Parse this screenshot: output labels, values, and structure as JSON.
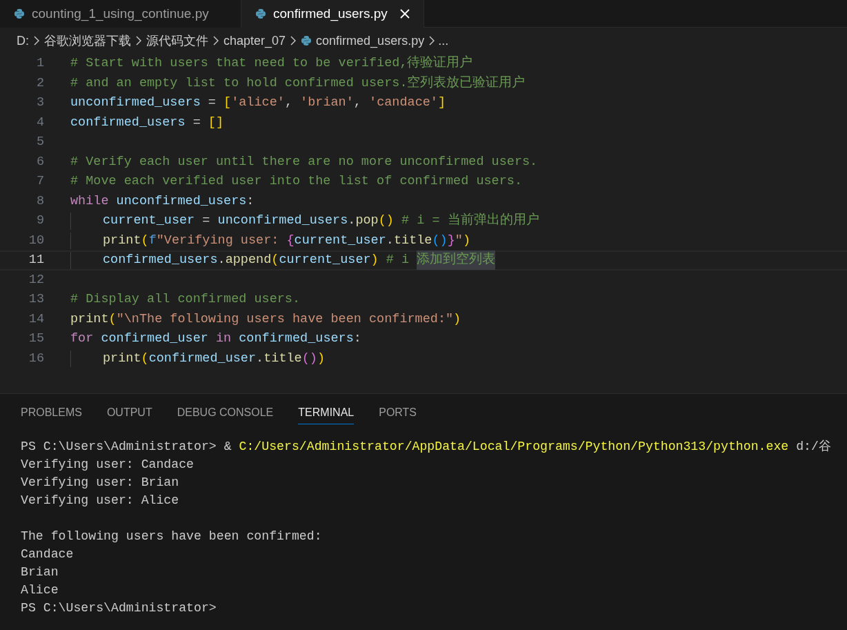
{
  "tabs": [
    {
      "label": "counting_1_using_continue.py",
      "selected": false
    },
    {
      "label": "confirmed_users.py",
      "selected": true
    }
  ],
  "breadcrumb": [
    {
      "label": "D:",
      "kind": "folder"
    },
    {
      "label": "谷歌浏览器下载",
      "kind": "folder"
    },
    {
      "label": "源代码文件",
      "kind": "folder"
    },
    {
      "label": "chapter_07",
      "kind": "folder"
    },
    {
      "label": "confirmed_users.py",
      "kind": "file"
    },
    {
      "label": "...",
      "kind": "more"
    }
  ],
  "code_lines": [
    {
      "number": "1",
      "current": false,
      "indented": false,
      "tokens": [
        {
          "text": "# Start with users that need to be verified,待验证用户",
          "kind": "comment"
        }
      ]
    },
    {
      "number": "2",
      "current": false,
      "indented": false,
      "tokens": [
        {
          "text": "# and an empty list to hold confirmed users.空列表放已验证用户",
          "kind": "comment"
        }
      ]
    },
    {
      "number": "3",
      "current": false,
      "indented": false,
      "tokens": [
        {
          "text": "unconfirmed_users",
          "kind": "variable"
        },
        {
          "text": " = ",
          "kind": "plain"
        },
        {
          "text": "[",
          "kind": "bracket1"
        },
        {
          "text": "'alice'",
          "kind": "string"
        },
        {
          "text": ", ",
          "kind": "plain"
        },
        {
          "text": "'brian'",
          "kind": "string"
        },
        {
          "text": ", ",
          "kind": "plain"
        },
        {
          "text": "'candace'",
          "kind": "string"
        },
        {
          "text": "]",
          "kind": "bracket1"
        }
      ]
    },
    {
      "number": "4",
      "current": false,
      "indented": false,
      "tokens": [
        {
          "text": "confirmed_users",
          "kind": "variable"
        },
        {
          "text": " = ",
          "kind": "plain"
        },
        {
          "text": "[]",
          "kind": "bracket1"
        }
      ]
    },
    {
      "number": "5",
      "current": false,
      "indented": false
    },
    {
      "number": "6",
      "current": false,
      "indented": false,
      "tokens": [
        {
          "text": "# Verify each user until there are no more unconfirmed users.",
          "kind": "comment"
        }
      ]
    },
    {
      "number": "7",
      "current": false,
      "indented": false,
      "tokens": [
        {
          "text": "# Move each verified user into the list of confirmed users.",
          "kind": "comment"
        }
      ]
    },
    {
      "number": "8",
      "current": false,
      "indented": false,
      "tokens": [
        {
          "text": "while",
          "kind": "keyword"
        },
        {
          "text": " unconfirmed_users",
          "kind": "variable"
        },
        {
          "text": ":",
          "kind": "plain"
        }
      ]
    },
    {
      "number": "9",
      "current": false,
      "indented": true,
      "tokens": [
        {
          "text": "current_user",
          "kind": "variable"
        },
        {
          "text": " = ",
          "kind": "plain"
        },
        {
          "text": "unconfirmed_users",
          "kind": "variable"
        },
        {
          "text": ".",
          "kind": "plain"
        },
        {
          "text": "pop",
          "kind": "function"
        },
        {
          "text": "()",
          "kind": "bracket1"
        },
        {
          "text": " # i = 当前弹出的用户",
          "kind": "comment"
        }
      ]
    },
    {
      "number": "10",
      "current": false,
      "indented": true,
      "tokens": [
        {
          "text": "print",
          "kind": "function"
        },
        {
          "text": "(",
          "kind": "bracket1"
        },
        {
          "text": "f",
          "kind": "storage"
        },
        {
          "text": "\"Verifying user: ",
          "kind": "string"
        },
        {
          "text": "{",
          "kind": "bracket2"
        },
        {
          "text": "current_user",
          "kind": "variable"
        },
        {
          "text": ".",
          "kind": "plain"
        },
        {
          "text": "title",
          "kind": "function"
        },
        {
          "text": "()",
          "kind": "bracket3"
        },
        {
          "text": "}",
          "kind": "bracket2"
        },
        {
          "text": "\"",
          "kind": "string"
        },
        {
          "text": ")",
          "kind": "bracket1"
        }
      ]
    },
    {
      "number": "11",
      "current": true,
      "indented": true,
      "tokens": [
        {
          "text": "confirmed_users",
          "kind": "variable"
        },
        {
          "text": ".",
          "kind": "plain"
        },
        {
          "text": "append",
          "kind": "function"
        },
        {
          "text": "(",
          "kind": "bracket1"
        },
        {
          "text": "current_user",
          "kind": "variable"
        },
        {
          "text": ")",
          "kind": "bracket1"
        },
        {
          "text": " # i ",
          "kind": "comment"
        },
        {
          "text": "添加到空列表",
          "kind": "selected_comment"
        }
      ]
    },
    {
      "number": "12",
      "current": false,
      "indented": false
    },
    {
      "number": "13",
      "current": false,
      "indented": false,
      "tokens": [
        {
          "text": "# Display all confirmed users.",
          "kind": "comment"
        }
      ]
    },
    {
      "number": "14",
      "current": false,
      "indented": false,
      "tokens": [
        {
          "text": "print",
          "kind": "function"
        },
        {
          "text": "(",
          "kind": "bracket1"
        },
        {
          "text": "\"\\nThe following users have been confirmed:\"",
          "kind": "string"
        },
        {
          "text": ")",
          "kind": "bracket1"
        }
      ]
    },
    {
      "number": "15",
      "current": false,
      "indented": false,
      "tokens": [
        {
          "text": "for",
          "kind": "keyword"
        },
        {
          "text": " confirmed_user",
          "kind": "variable"
        },
        {
          "text": " in",
          "kind": "keyword"
        },
        {
          "text": " confirmed_users",
          "kind": "variable"
        },
        {
          "text": ":",
          "kind": "plain"
        }
      ]
    },
    {
      "number": "16",
      "current": false,
      "indented": true,
      "tokens": [
        {
          "text": "print",
          "kind": "function"
        },
        {
          "text": "(",
          "kind": "bracket1"
        },
        {
          "text": "confirmed_user",
          "kind": "variable"
        },
        {
          "text": ".",
          "kind": "plain"
        },
        {
          "text": "title",
          "kind": "function"
        },
        {
          "text": "()",
          "kind": "bracket2"
        },
        {
          "text": ")",
          "kind": "bracket1"
        }
      ]
    }
  ],
  "panel_tabs": [
    {
      "label": "PROBLEMS",
      "selected": false
    },
    {
      "label": "OUTPUT",
      "selected": false
    },
    {
      "label": "DEBUG CONSOLE",
      "selected": false
    },
    {
      "label": "TERMINAL",
      "selected": true
    },
    {
      "label": "PORTS",
      "selected": false
    }
  ],
  "terminal_lines": [
    [
      {
        "text": "PS C:\\Users\\Administrator> & ",
        "kind": "plain"
      },
      {
        "text": "C:/Users/Administrator/AppData/Local/Programs/Python/Python313/python.exe",
        "kind": "path"
      },
      {
        "text": " d:/谷",
        "kind": "plain"
      }
    ],
    [
      {
        "text": "Verifying user: Candace",
        "kind": "plain"
      }
    ],
    [
      {
        "text": "Verifying user: Brian",
        "kind": "plain"
      }
    ],
    [
      {
        "text": "Verifying user: Alice",
        "kind": "plain"
      }
    ],
    [
      {
        "text": "The following users have been confirmed:",
        "kind": "plain",
        "gap_before": true
      }
    ],
    [
      {
        "text": "Candace",
        "kind": "plain"
      }
    ],
    [
      {
        "text": "Brian",
        "kind": "plain"
      }
    ],
    [
      {
        "text": "Alice",
        "kind": "plain"
      }
    ],
    [
      {
        "text": "PS C:\\Users\\Administrator>",
        "kind": "plain"
      }
    ]
  ]
}
